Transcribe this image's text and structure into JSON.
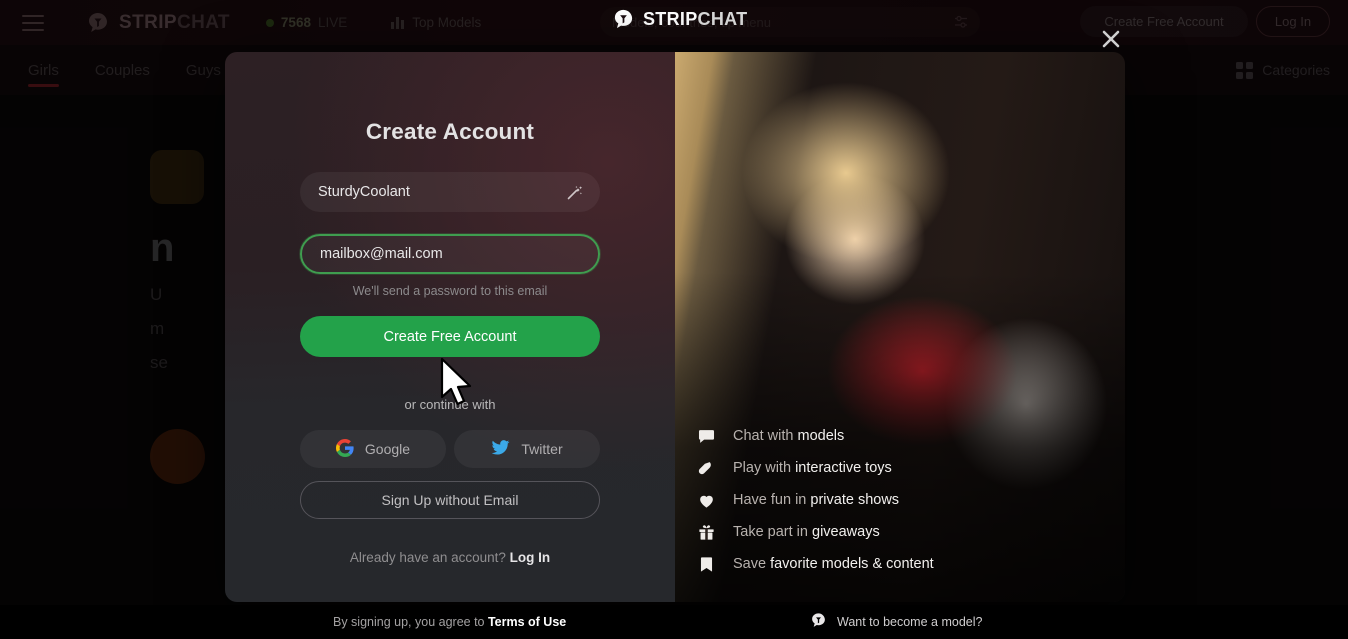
{
  "header": {
    "menu_icon": "hamburger-icon",
    "brand_strip": "STRIP",
    "brand_chat": "CHAT",
    "live_count": "7568",
    "live_label": "LIVE",
    "top_models": "Top Models",
    "search_placeholder": "Models, countries, tip menu",
    "filter_icon": "sliders-icon",
    "create_account": "Create Free Account",
    "log_in": "Log In",
    "watermark_strip": "STRIP",
    "watermark_chat": "CHAT"
  },
  "nav": {
    "items": [
      {
        "label": "Girls",
        "active": true
      },
      {
        "label": "Couples",
        "active": false
      },
      {
        "label": "Guys",
        "active": false
      }
    ],
    "categories": "Categories"
  },
  "background": {
    "headline": "n",
    "line1": "U",
    "line2": "m",
    "line3": "se"
  },
  "modal": {
    "title": "Create Account",
    "username_value": "SturdyCoolant",
    "username_icon": "magic-wand-icon",
    "email_value": "mailbox@mail.com",
    "email_helper": "We'll send a password to this email",
    "submit_label": "Create Free Account",
    "divider": "or continue with",
    "social": [
      {
        "label": "Google",
        "icon": "google-icon"
      },
      {
        "label": "Twitter",
        "icon": "twitter-icon"
      }
    ],
    "no_email_label": "Sign Up without Email",
    "already_text": "Already have an account? ",
    "already_link": "Log In",
    "close_icon": "close-icon",
    "features": [
      {
        "icon": "chat-bubble-icon",
        "plain": "Chat with ",
        "bold": "models"
      },
      {
        "icon": "toy-icon",
        "plain": "Play with ",
        "bold": "interactive toys"
      },
      {
        "icon": "heart-icon",
        "plain": "Have fun in ",
        "bold": "private shows"
      },
      {
        "icon": "gift-icon",
        "plain": "Take part in ",
        "bold": "giveaways"
      },
      {
        "icon": "bookmark-icon",
        "plain": "Save ",
        "bold": "favorite models & content"
      }
    ]
  },
  "footer": {
    "terms_prefix": "By signing up, you agree to ",
    "terms_link": "Terms of Use",
    "become_model": "Want to become a model?"
  },
  "colors": {
    "accent_green": "#23a24a",
    "brand_red": "#7d1d24",
    "live_green": "#3f5b22"
  }
}
